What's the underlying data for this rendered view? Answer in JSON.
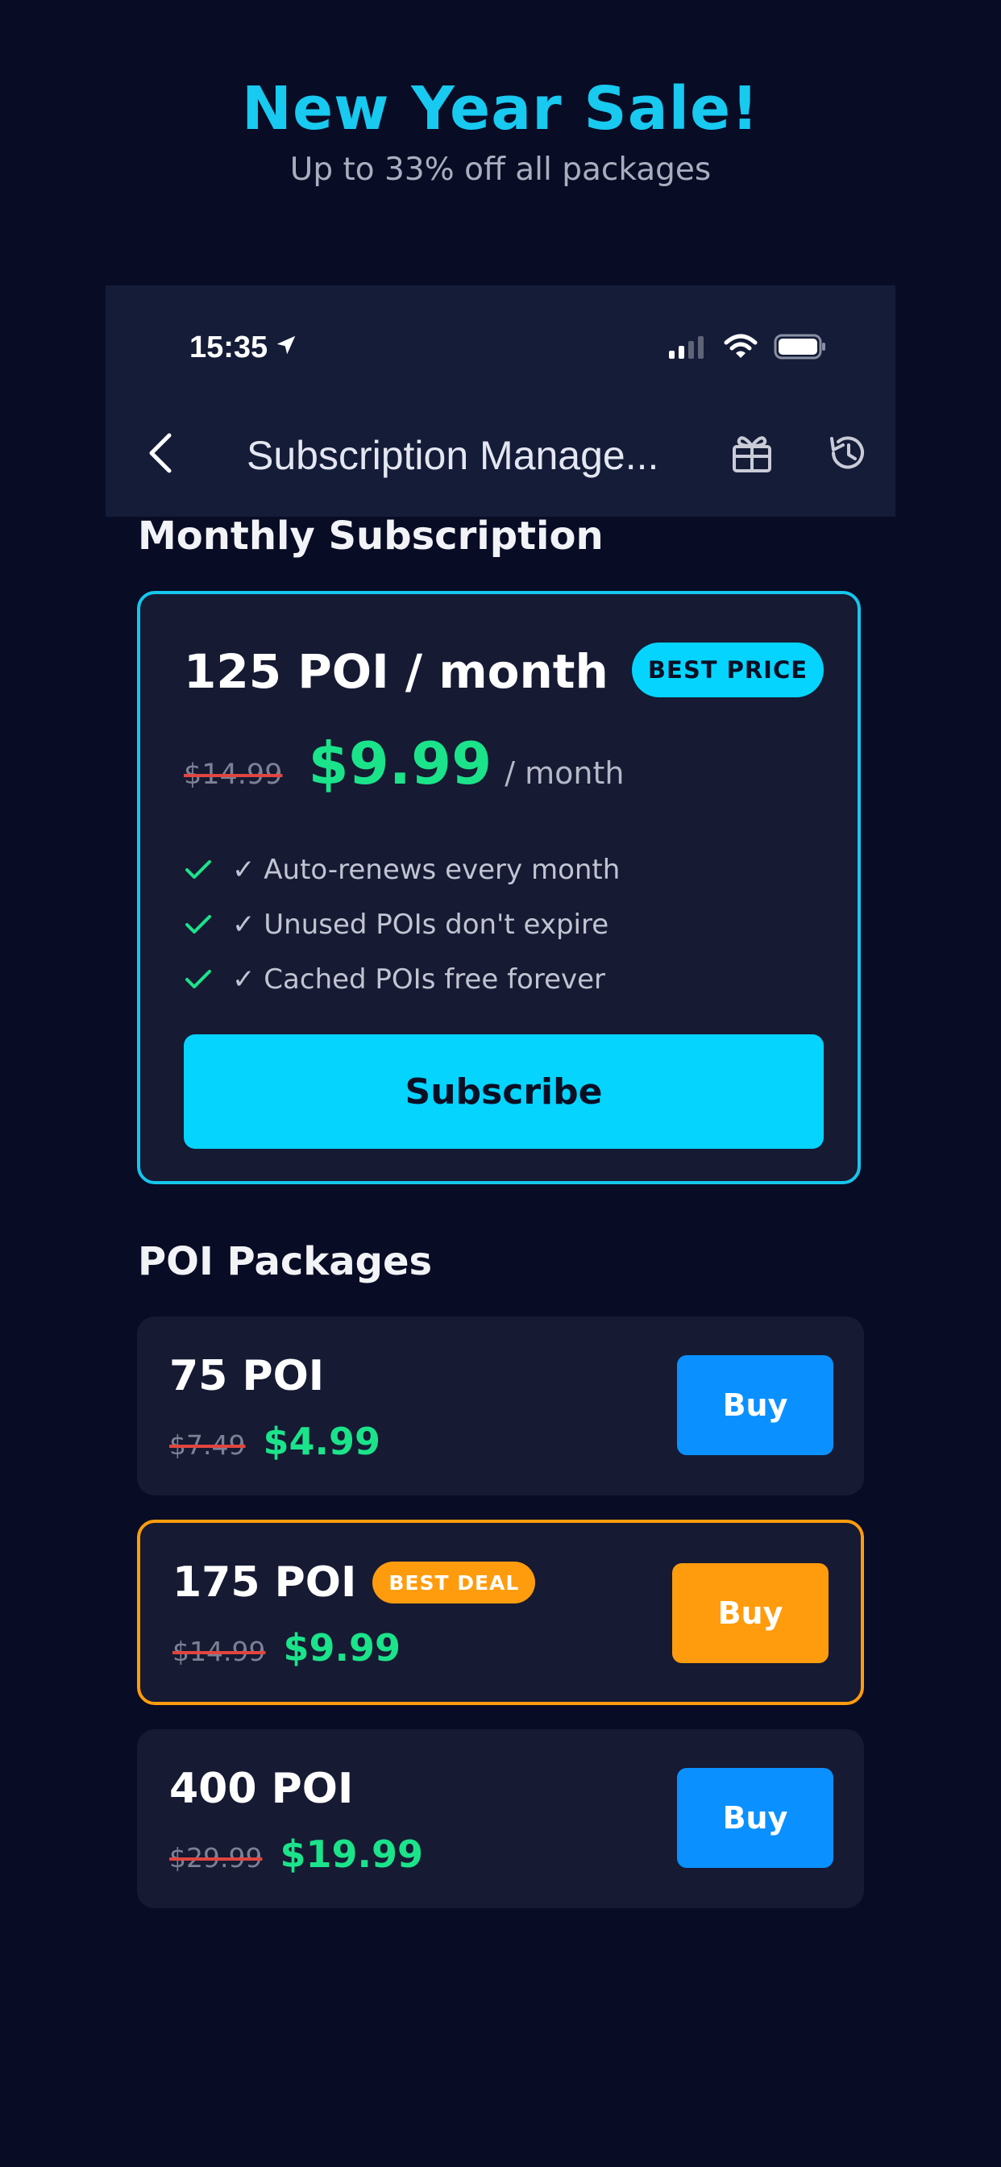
{
  "promo": {
    "title": "New Year Sale!",
    "subtitle": "Up to 33% off all packages"
  },
  "status_bar": {
    "time": "15:35",
    "icons": [
      "location-arrow-icon",
      "signal-icon",
      "wifi-icon",
      "battery-icon"
    ]
  },
  "nav": {
    "title": "Subscription Manage...",
    "icons": [
      "back-chevron-icon",
      "gift-icon",
      "history-icon"
    ]
  },
  "monthly": {
    "section_title": "Monthly Subscription",
    "plan": "125 POI / month",
    "badge": "BEST PRICE",
    "old_price": "$14.99",
    "price": "$9.99",
    "period": "/ month",
    "features": [
      "✓ Auto-renews every month",
      "✓ Unused POIs don't expire",
      "✓ Cached POIs free forever"
    ],
    "cta": "Subscribe"
  },
  "packages": {
    "section_title": "POI Packages",
    "items": [
      {
        "name": "75 POI",
        "old_price": "$7.49",
        "price": "$4.99",
        "cta": "Buy"
      },
      {
        "name": "175 POI",
        "badge": "BEST DEAL",
        "old_price": "$14.99",
        "price": "$9.99",
        "cta": "Buy"
      },
      {
        "name": "400 POI",
        "old_price": "$29.99",
        "price": "$19.99",
        "cta": "Buy"
      }
    ]
  },
  "colors": {
    "background": "#080c25",
    "accent_cyan": "#05d4ff",
    "accent_orange": "#ff9c0d",
    "accent_blue": "#0a91ff",
    "price_green": "#1be38a",
    "strike_red": "#e0453f"
  }
}
